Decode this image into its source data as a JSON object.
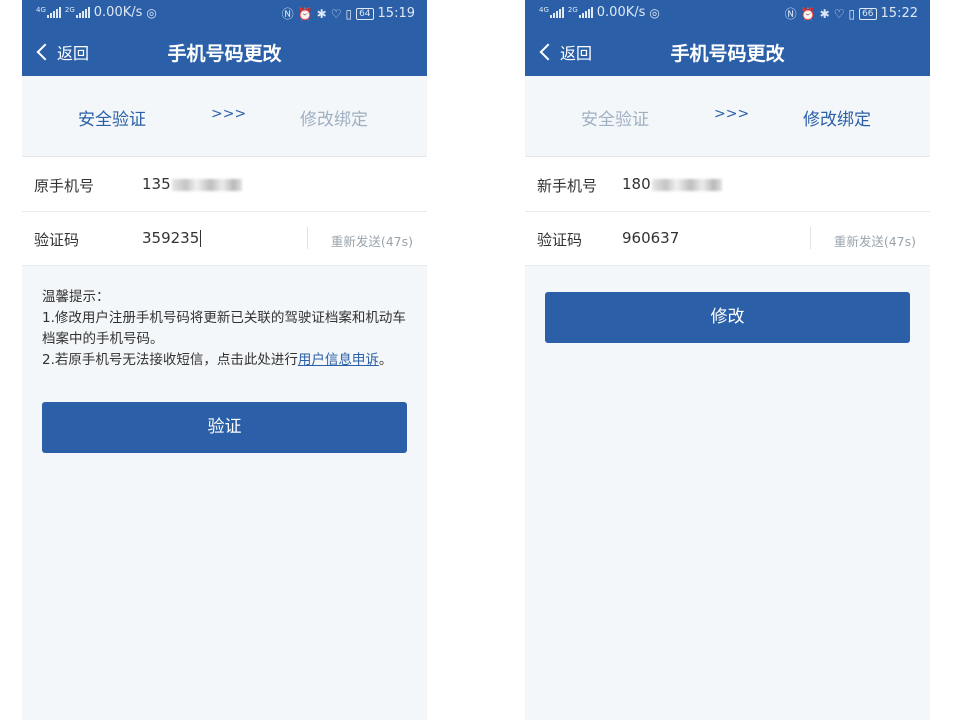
{
  "left": {
    "status": {
      "speed": "0.00K/s",
      "battery": "64",
      "time": "15:19",
      "sig1": "4G",
      "sig2": "2G"
    },
    "nav": {
      "back": "返回",
      "title": "手机号码更改"
    },
    "steps": {
      "step1": "安全验证",
      "sep": ">>>",
      "step2": "修改绑定"
    },
    "form": {
      "phone_label": "原手机号",
      "phone_value": "135",
      "code_label": "验证码",
      "code_value": "359235",
      "resend": "重新发送(47s)"
    },
    "tips": {
      "title": "温馨提示：",
      "line1": "1.修改用户注册手机号码将更新已关联的驾驶证档案和机动车档案中的手机号码。",
      "line2_prefix": "2.若原手机号无法接收短信，点击此处进行",
      "line2_link": "用户信息申诉",
      "line2_suffix": "。"
    },
    "button": "验证"
  },
  "right": {
    "status": {
      "speed": "0.00K/s",
      "battery": "66",
      "time": "15:22",
      "sig1": "4G",
      "sig2": "2G"
    },
    "nav": {
      "back": "返回",
      "title": "手机号码更改"
    },
    "steps": {
      "step1": "安全验证",
      "sep": ">>>",
      "step2": "修改绑定"
    },
    "form": {
      "phone_label": "新手机号",
      "phone_value": "180",
      "code_label": "验证码",
      "code_value": "960637",
      "resend": "重新发送(47s)"
    },
    "button": "修改"
  },
  "colors": {
    "primary": "#2b60a8",
    "step_inactive": "#9fb0c2",
    "background": "#f3f7f9"
  }
}
